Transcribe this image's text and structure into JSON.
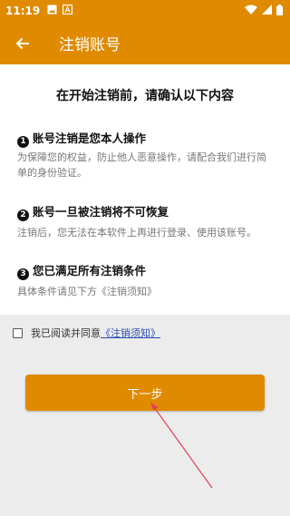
{
  "status_bar": {
    "time": "11:19",
    "icons": [
      "image-icon",
      "app-icon",
      "wifi-icon",
      "signal-icon",
      "battery-icon"
    ]
  },
  "app_bar": {
    "title": "注销账号",
    "back_icon": "arrow-left-icon"
  },
  "content": {
    "headline": "在开始注销前，请确认以下内容",
    "sections": [
      {
        "num": "1",
        "title": "账号注销是您本人操作",
        "body": "为保障您的权益，防止他人恶意操作，请配合我们进行简单的身份验证。"
      },
      {
        "num": "2",
        "title": "账号一旦被注销将不可恢复",
        "body": "注销后，您无法在本软件上再进行登录、使用该账号。"
      },
      {
        "num": "3",
        "title": "您已满足所有注销条件",
        "body": "具体条件请见下方《注销须知》"
      }
    ]
  },
  "agreement": {
    "checked": false,
    "text": "我已阅读并同意",
    "link": "《注销须知》"
  },
  "next_button": {
    "label": "下一步"
  },
  "colors": {
    "accent": "#e08a00",
    "link": "#2a4fb4",
    "background": "#ececec",
    "annotation_arrow": "#e0405a"
  }
}
